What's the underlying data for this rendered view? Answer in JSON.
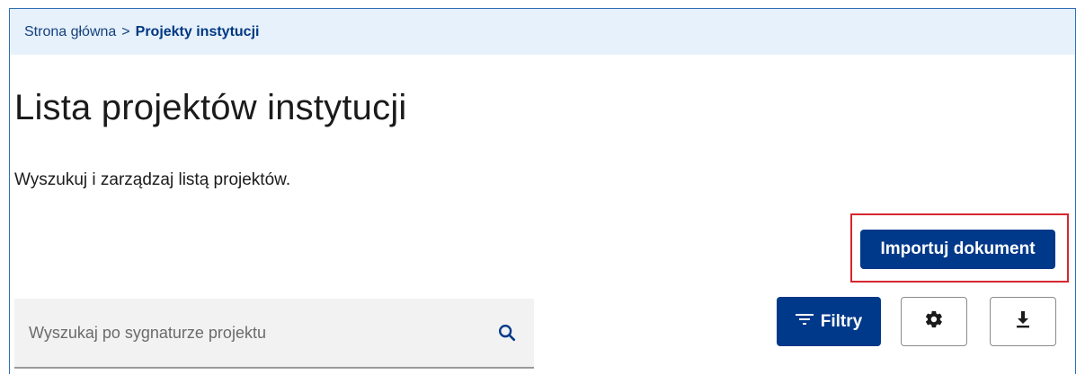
{
  "breadcrumb": {
    "home": "Strona główna",
    "separator": ">",
    "current": "Projekty instytucji"
  },
  "header": {
    "title": "Lista projektów instytucji",
    "description": "Wyszukuj i zarządzaj listą projektów."
  },
  "actions": {
    "import_label": "Importuj dokument",
    "filter_label": "Filtry",
    "settings_icon": "gear-icon",
    "download_icon": "download-icon",
    "filter_icon": "filter-lines-icon"
  },
  "search": {
    "placeholder": "Wyszukaj po sygnaturze projektu",
    "icon": "search-icon"
  },
  "colors": {
    "primary": "#00398a",
    "breadcrumb_bg": "#e6f1fb",
    "highlight": "#d6262f",
    "search_bg": "#f2f2f2"
  }
}
